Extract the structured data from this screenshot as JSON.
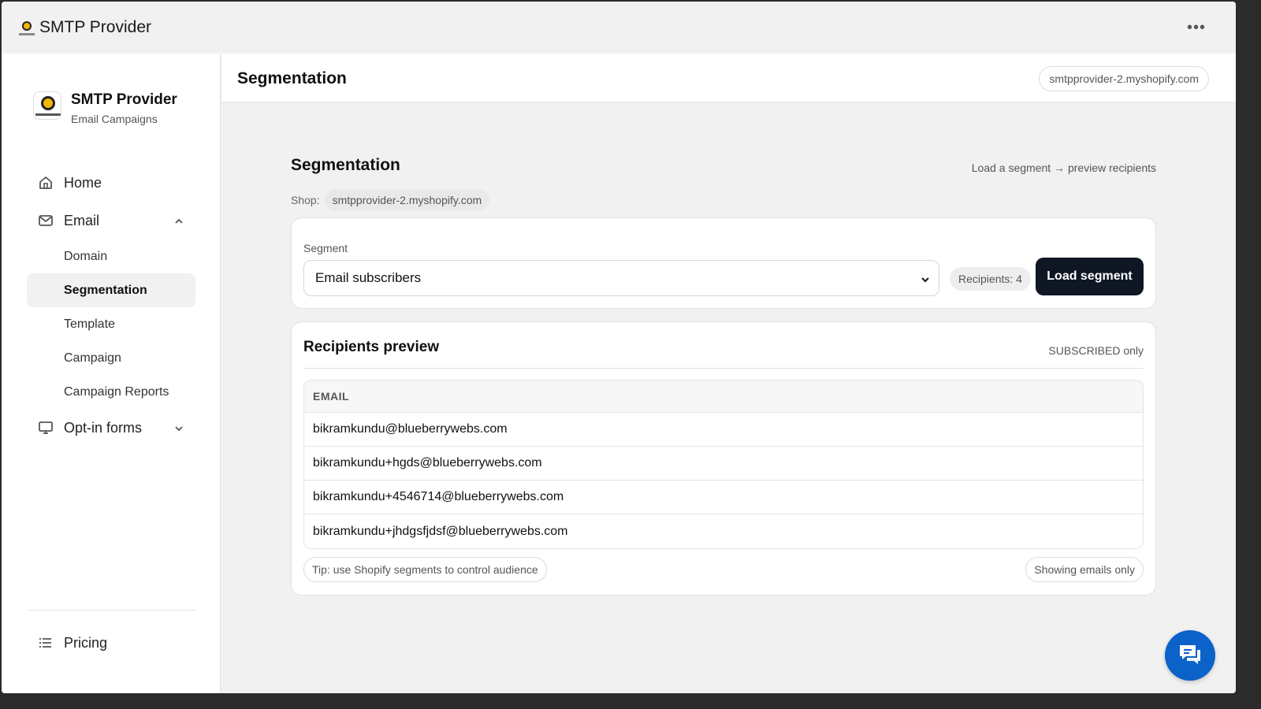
{
  "window": {
    "title": "SMTP Provider",
    "more_icon": "more-horizontal-icon"
  },
  "sidebar": {
    "brand_name": "SMTP Provider",
    "brand_sub": "Email Campaigns",
    "items": [
      {
        "label": "Home",
        "icon": "home-icon"
      },
      {
        "label": "Email",
        "icon": "mail-icon",
        "expanded": true
      },
      {
        "label": "Opt-in forms",
        "icon": "monitor-icon",
        "expanded": false
      }
    ],
    "email_sub": [
      {
        "label": "Domain"
      },
      {
        "label": "Segmentation",
        "active": true
      },
      {
        "label": "Template"
      },
      {
        "label": "Campaign"
      },
      {
        "label": "Campaign Reports"
      }
    ],
    "pricing": {
      "label": "Pricing",
      "icon": "list-icon"
    }
  },
  "header": {
    "title": "Segmentation",
    "shop": "smtpprovider-2.myshopify.com"
  },
  "content": {
    "title": "Segmentation",
    "hint": "Load a segment → preview recipients",
    "shop_label": "Shop:",
    "shop_value": "smtpprovider-2.myshopify.com",
    "segment": {
      "label": "Segment",
      "selected": "Email subscribers",
      "recipients": "Recipients: 4",
      "load_button": "Load segment"
    },
    "preview": {
      "title": "Recipients preview",
      "filter": "SUBSCRIBED only",
      "column": "EMAIL",
      "rows": [
        "bikramkundu@blueberrywebs.com",
        "bikramkundu+hgds@blueberrywebs.com",
        "bikramkundu+4546714@blueberrywebs.com",
        "bikramkundu+jhdgsfjdsf@blueberrywebs.com"
      ],
      "tip": "Tip: use Shopify segments to control audience",
      "note": "Showing emails only"
    }
  },
  "colors": {
    "primary_button": "#0f1724",
    "chat_button": "#0b62c9",
    "accent_bg": "#f1f1f1"
  }
}
